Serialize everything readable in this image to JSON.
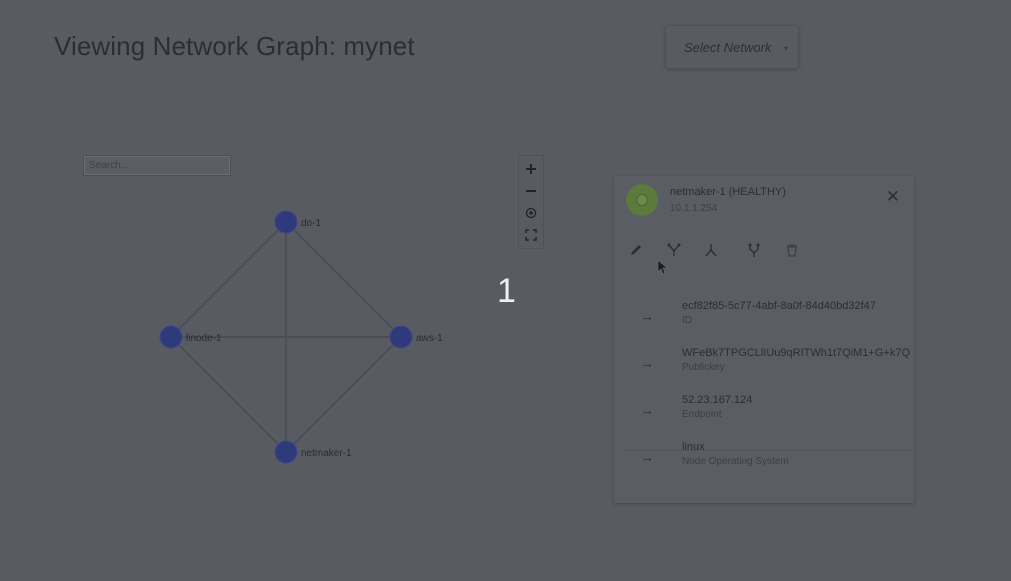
{
  "header": {
    "title": "Viewing Network Graph: mynet"
  },
  "network_select": {
    "label": "Select Network",
    "caret": "▾"
  },
  "search": {
    "placeholder": "Search..."
  },
  "zoom_controls": {
    "zoom_in": "+",
    "zoom_out": "−",
    "center": "◎",
    "fullscreen": "⛶"
  },
  "overlay": {
    "count": "1"
  },
  "graph": {
    "nodes": [
      {
        "id": "do-1",
        "label": "do-1"
      },
      {
        "id": "linode-1",
        "label": "linode-1"
      },
      {
        "id": "aws-1",
        "label": "aws-1"
      },
      {
        "id": "netmaker-1",
        "label": "netmaker-1"
      }
    ],
    "edges": [
      [
        "do-1",
        "linode-1"
      ],
      [
        "do-1",
        "aws-1"
      ],
      [
        "do-1",
        "netmaker-1"
      ],
      [
        "linode-1",
        "aws-1"
      ],
      [
        "linode-1",
        "netmaker-1"
      ],
      [
        "aws-1",
        "netmaker-1"
      ]
    ],
    "node_color": "#2f3a7a"
  },
  "details_panel": {
    "name": "netmaker-1 (HEALTHY)",
    "address": "10.1.1.254",
    "close": "✕",
    "actions": [
      "edit-icon",
      "relay-icon",
      "merge-icon",
      "egress-icon",
      "delete-icon"
    ],
    "properties": [
      {
        "value": "ecf82f85-5c77-4abf-8a0f-84d40bd32f47",
        "key": "ID"
      },
      {
        "value": "WFeBk7TPGCLlIUu9qRITWh1t7QiM1+G+k7Q",
        "key": "Publickey"
      },
      {
        "value": "52.23.167.124",
        "key": "Endpoint"
      },
      {
        "value": "linux",
        "key": "Node Operating System"
      }
    ],
    "arrow": "→"
  }
}
